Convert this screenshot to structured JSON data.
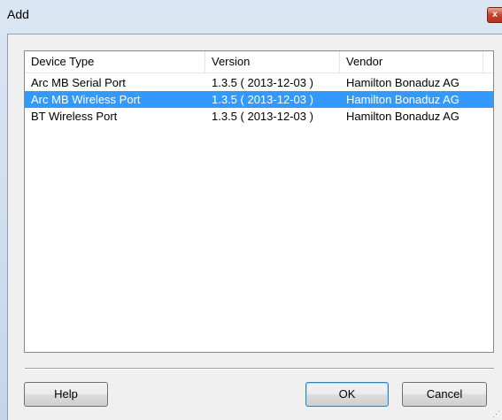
{
  "window": {
    "title": "Add",
    "close_label": "x"
  },
  "listview": {
    "columns": [
      "Device Type",
      "Version",
      "Vendor"
    ],
    "rows": [
      {
        "device_type": "Arc MB Serial Port",
        "version": "1.3.5 ( 2013-12-03 )",
        "vendor": "Hamilton Bonaduz AG",
        "selected": false
      },
      {
        "device_type": "Arc MB Wireless Port",
        "version": "1.3.5 ( 2013-12-03 )",
        "vendor": "Hamilton Bonaduz AG",
        "selected": true
      },
      {
        "device_type": "BT Wireless Port",
        "version": "1.3.5 ( 2013-12-03 )",
        "vendor": "Hamilton Bonaduz AG",
        "selected": false
      }
    ]
  },
  "buttons": {
    "help": "Help",
    "ok": "OK",
    "cancel": "Cancel"
  },
  "colors": {
    "selection": "#3399ff",
    "window_frame": "#c5d6ea",
    "client_bg": "#f0f0f0"
  }
}
